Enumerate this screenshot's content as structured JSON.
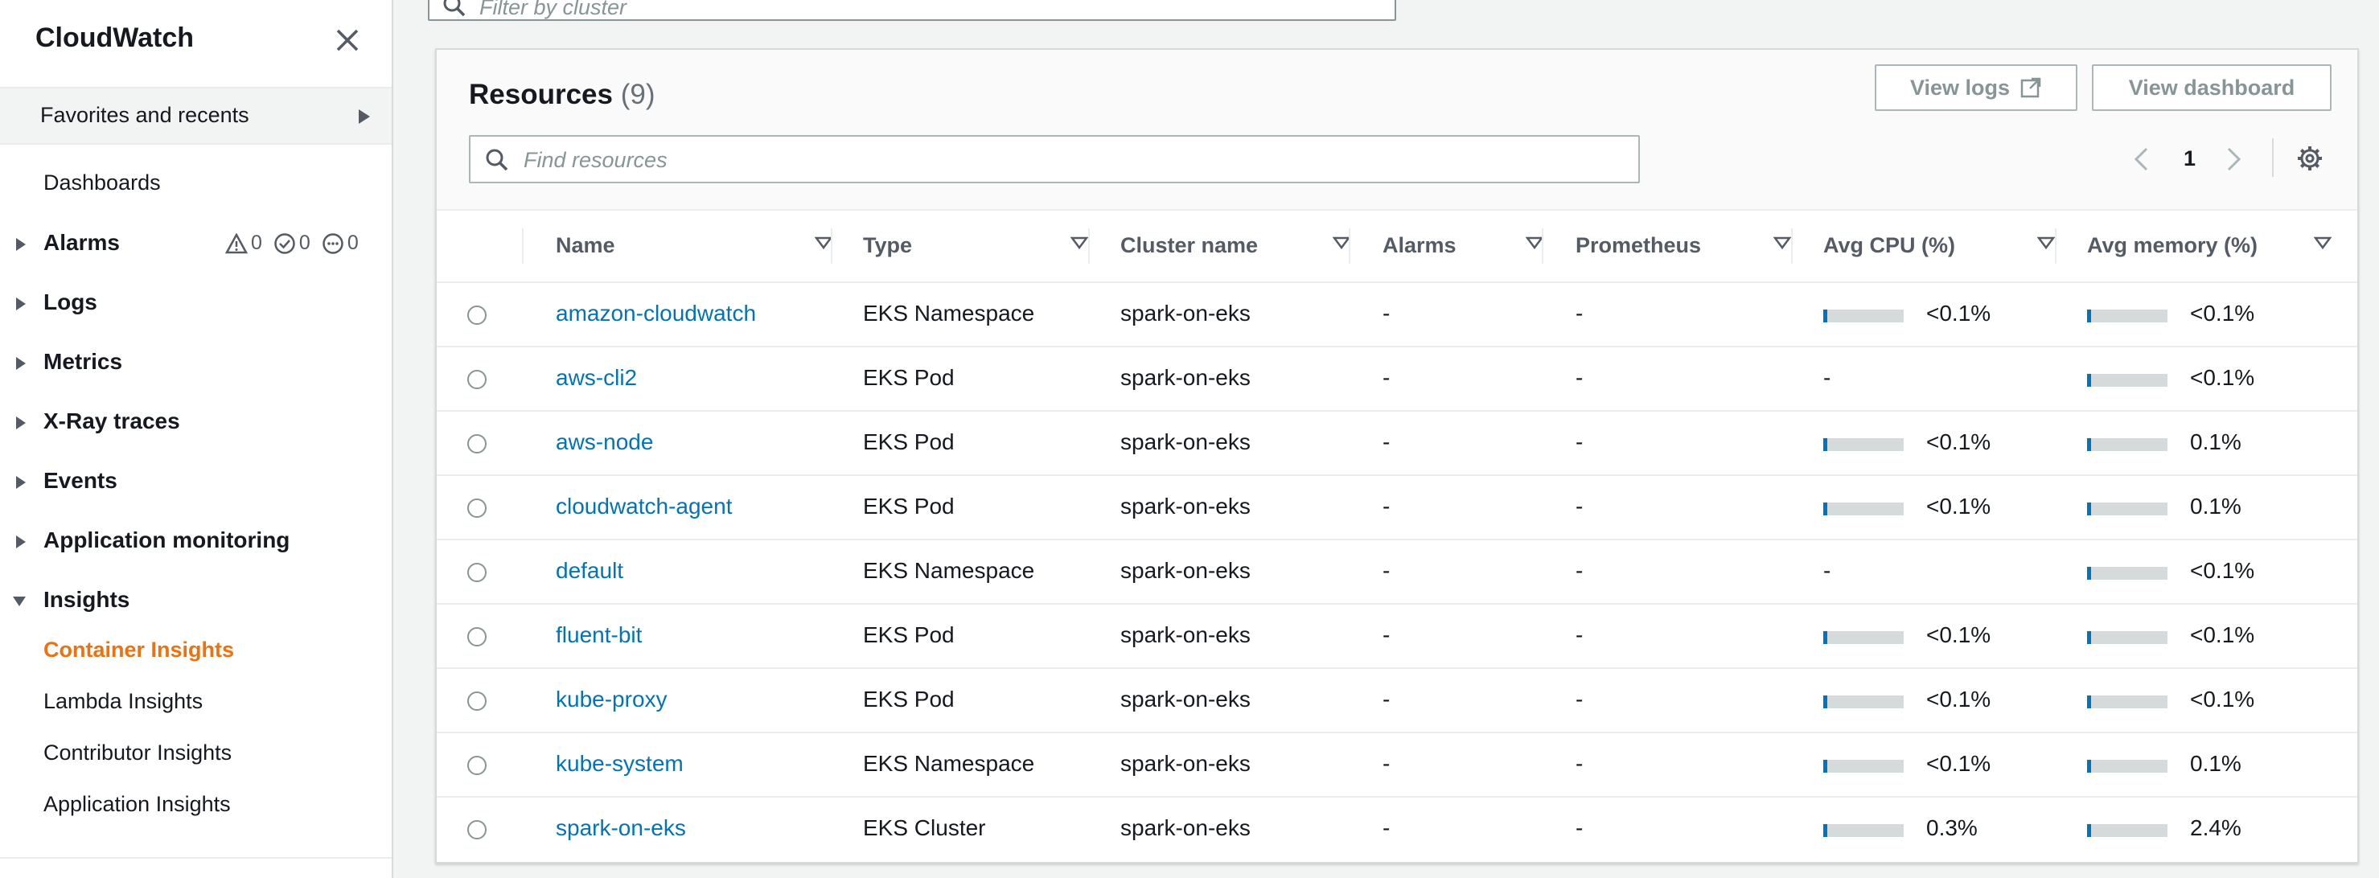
{
  "sidebar": {
    "title": "CloudWatch",
    "favorites_label": "Favorites and recents",
    "dashboards_label": "Dashboards",
    "groups": {
      "alarms": "Alarms",
      "logs": "Logs",
      "metrics": "Metrics",
      "xray": "X-Ray traces",
      "events": "Events",
      "appmon": "Application monitoring",
      "insights": "Insights"
    },
    "alarm_counts": {
      "alarm": "0",
      "ok": "0",
      "insufficient": "0"
    },
    "insights_items": {
      "container": "Container Insights",
      "lambda": "Lambda Insights",
      "contributor": "Contributor Insights",
      "application": "Application Insights"
    }
  },
  "filter": {
    "placeholder": "Filter by cluster"
  },
  "resources": {
    "title": "Resources",
    "count": "(9)",
    "view_logs_label": "View logs",
    "view_dashboard_label": "View dashboard",
    "search_placeholder": "Find resources",
    "page": "1",
    "columns": {
      "name": "Name",
      "type": "Type",
      "cluster": "Cluster name",
      "alarms": "Alarms",
      "prometheus": "Prometheus",
      "cpu": "Avg CPU (%)",
      "memory": "Avg memory (%)"
    },
    "rows": [
      {
        "name": "amazon-cloudwatch",
        "type": "EKS Namespace",
        "cluster": "spark-on-eks",
        "alarms": "-",
        "prometheus": "-",
        "cpu": "<0.1%",
        "cpu_fill": 0.05,
        "memory": "<0.1%",
        "mem_fill": 0.05
      },
      {
        "name": "aws-cli2",
        "type": "EKS Pod",
        "cluster": "spark-on-eks",
        "alarms": "-",
        "prometheus": "-",
        "cpu": "-",
        "cpu_fill": null,
        "memory": "<0.1%",
        "mem_fill": 0.05
      },
      {
        "name": "aws-node",
        "type": "EKS Pod",
        "cluster": "spark-on-eks",
        "alarms": "-",
        "prometheus": "-",
        "cpu": "<0.1%",
        "cpu_fill": 0.05,
        "memory": "0.1%",
        "mem_fill": 0.05
      },
      {
        "name": "cloudwatch-agent",
        "type": "EKS Pod",
        "cluster": "spark-on-eks",
        "alarms": "-",
        "prometheus": "-",
        "cpu": "<0.1%",
        "cpu_fill": 0.05,
        "memory": "0.1%",
        "mem_fill": 0.05
      },
      {
        "name": "default",
        "type": "EKS Namespace",
        "cluster": "spark-on-eks",
        "alarms": "-",
        "prometheus": "-",
        "cpu": "-",
        "cpu_fill": null,
        "memory": "<0.1%",
        "mem_fill": 0.05
      },
      {
        "name": "fluent-bit",
        "type": "EKS Pod",
        "cluster": "spark-on-eks",
        "alarms": "-",
        "prometheus": "-",
        "cpu": "<0.1%",
        "cpu_fill": 0.05,
        "memory": "<0.1%",
        "mem_fill": 0.05
      },
      {
        "name": "kube-proxy",
        "type": "EKS Pod",
        "cluster": "spark-on-eks",
        "alarms": "-",
        "prometheus": "-",
        "cpu": "<0.1%",
        "cpu_fill": 0.05,
        "memory": "<0.1%",
        "mem_fill": 0.05
      },
      {
        "name": "kube-system",
        "type": "EKS Namespace",
        "cluster": "spark-on-eks",
        "alarms": "-",
        "prometheus": "-",
        "cpu": "<0.1%",
        "cpu_fill": 0.05,
        "memory": "0.1%",
        "mem_fill": 0.05
      },
      {
        "name": "spark-on-eks",
        "type": "EKS Cluster",
        "cluster": "spark-on-eks",
        "alarms": "-",
        "prometheus": "-",
        "cpu": "0.3%",
        "cpu_fill": 0.05,
        "memory": "2.4%",
        "mem_fill": 0.05
      }
    ]
  },
  "colors": {
    "accent": "#ec7211",
    "link": "#0073bb"
  }
}
